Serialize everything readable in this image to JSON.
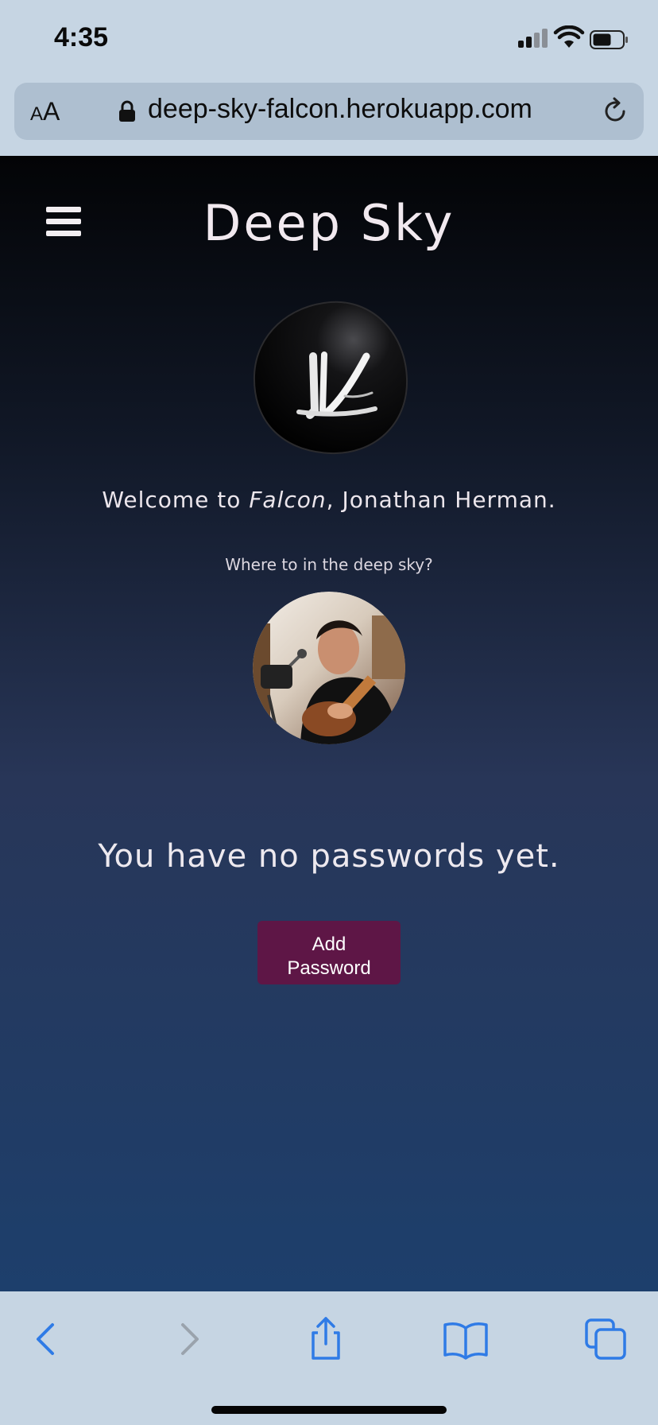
{
  "status_bar": {
    "time": "4:35",
    "icons": [
      "signal-icon",
      "wifi-icon",
      "battery-icon"
    ]
  },
  "browser": {
    "text_size_label_small": "A",
    "text_size_label_big": "A",
    "url": "deep-sky-falcon.herokuapp.com",
    "icons": [
      "lock-icon",
      "reload-icon"
    ],
    "toolbar_icons": [
      "back-icon",
      "forward-icon",
      "share-icon",
      "bookmarks-icon",
      "tabs-icon"
    ]
  },
  "page": {
    "site_title": "Deep Sky",
    "welcome_prefix": "Welcome to ",
    "app_name": "Falcon",
    "welcome_suffix": ", Jonathan Herman.",
    "subtitle": "Where to in the deep sky?",
    "empty_message": "You have no passwords yet.",
    "add_button_line1": "Add",
    "add_button_line2": "Password"
  },
  "colors": {
    "accent_button": "#5e1646",
    "browser_chrome": "#c6d5e3",
    "ios_blue": "#2f7be6"
  }
}
